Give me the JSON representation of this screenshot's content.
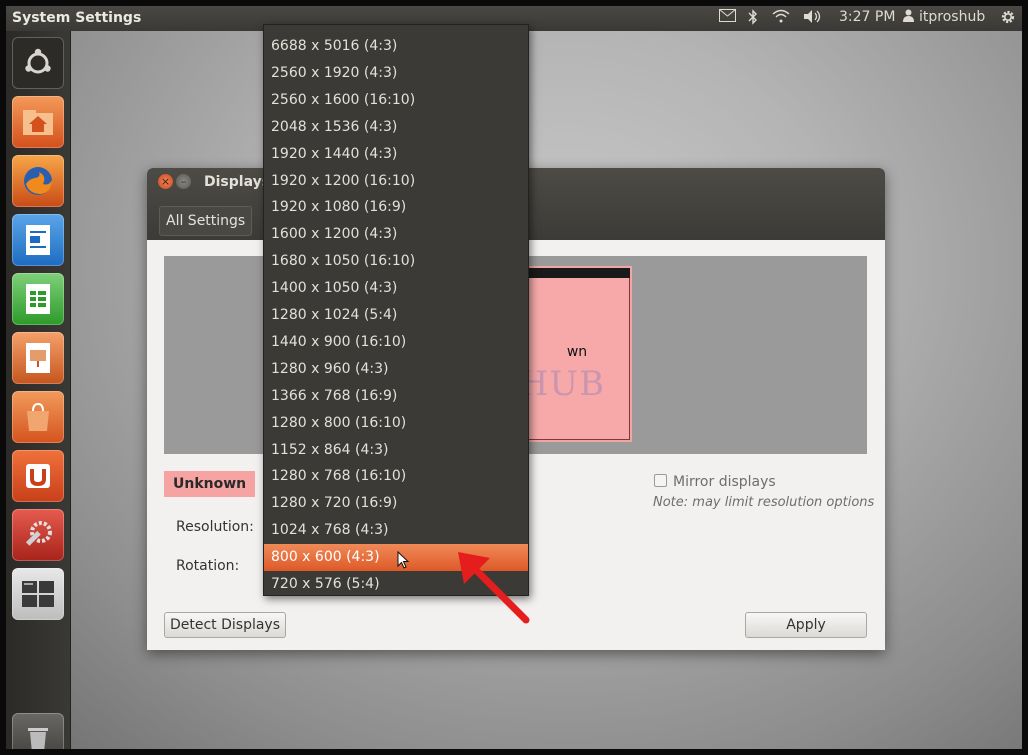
{
  "panel": {
    "title": "System Settings",
    "time": "3:27 PM",
    "user": "itproshub"
  },
  "launcher": {
    "items": [
      "dash-home",
      "home-folder",
      "firefox",
      "libreoffice-writer",
      "libreoffice-calc",
      "libreoffice-impress",
      "ubuntu-software-center",
      "ubuntu-one",
      "system-settings",
      "workspace-switcher",
      "trash"
    ]
  },
  "window": {
    "title": "Displays",
    "all_settings": "All Settings",
    "monitor_label": "wn",
    "display_badge": "Unknown",
    "resolution_label": "Resolution:",
    "rotation_label": "Rotation:",
    "mirror_label": "Mirror displays",
    "note": "Note: may limit resolution options",
    "detect_button": "Detect Displays",
    "apply_button": "Apply",
    "watermark": "IT Pros HUB"
  },
  "resolution_menu": {
    "options": [
      "6688 x 5016 (4:3)",
      "2560 x 1920 (4:3)",
      "2560 x 1600 (16:10)",
      "2048 x 1536 (4:3)",
      "1920 x 1440 (4:3)",
      "1920 x 1200 (16:10)",
      "1920 x 1080 (16:9)",
      "1600 x 1200 (4:3)",
      "1680 x 1050 (16:10)",
      "1400 x 1050 (4:3)",
      "1280 x 1024 (5:4)",
      "1440 x 900 (16:10)",
      "1280 x 960 (4:3)",
      "1366 x 768 (16:9)",
      "1280 x 800 (16:10)",
      "1152 x 864 (4:3)",
      "1280 x 768 (16:10)",
      "1280 x 720 (16:9)",
      "1024 x 768 (4:3)",
      "800 x 600 (4:3)",
      "720 x 576 (5:4)"
    ],
    "highlighted": "800 x 600 (4:3)"
  },
  "colors": {
    "highlight": "#e8693a",
    "panel": "#3c3b37",
    "badge": "#f6a3a3",
    "arrow": "#e51d1d"
  }
}
